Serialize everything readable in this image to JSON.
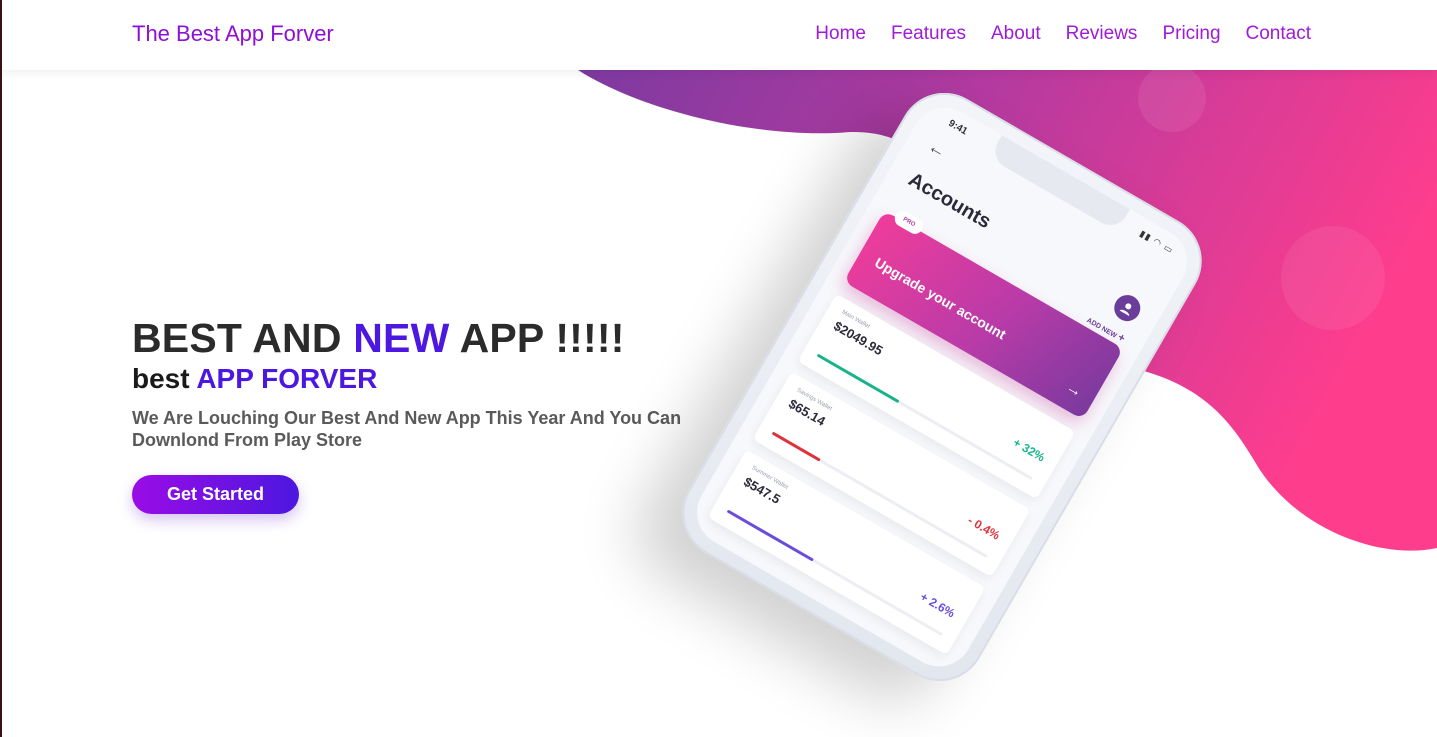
{
  "navbar": {
    "brand": "The Best App Forver",
    "links": [
      {
        "label": "Home"
      },
      {
        "label": "Features"
      },
      {
        "label": "About"
      },
      {
        "label": "Reviews"
      },
      {
        "label": "Pricing"
      },
      {
        "label": "Contact"
      }
    ]
  },
  "hero": {
    "title_part1": "BEST AND ",
    "title_accent": "NEW",
    "title_part2": " APP !!!!!",
    "subtitle_part1": "best ",
    "subtitle_accent": "APP FORVER",
    "description": "We Are Louching Our Best And New App This Year And You Can Downlond From Play Store",
    "cta_label": "Get Started"
  },
  "phone": {
    "status_time": "9:41",
    "status_icons": "▮▮ ◠ ▭",
    "back_icon": "←",
    "screen_title": "Accounts",
    "add_new_label": "ADD NEW",
    "add_new_icon": "+",
    "upgrade": {
      "badge": "PRO",
      "text": "Upgrade your account",
      "arrow_icon": "→"
    },
    "wallets": [
      {
        "name": "Main Wallet",
        "amount": "$2049.95",
        "change": "+ 32%",
        "progress": 0.38,
        "color": "#18b38a"
      },
      {
        "name": "Savings Wallet",
        "amount": "$65.14",
        "change": "- 0.4%",
        "progress": 0.22,
        "color": "#e0323c"
      },
      {
        "name": "Summer Wallet",
        "amount": "$547.5",
        "change": "+ 2.6%",
        "progress": 0.4,
        "color": "#6a4cdc"
      }
    ]
  },
  "colors": {
    "brand_purple": "#8e10d6",
    "accent_blue": "#4c17e0",
    "blob_start": "#7d3aa0",
    "blob_end": "#ff3d8d"
  }
}
